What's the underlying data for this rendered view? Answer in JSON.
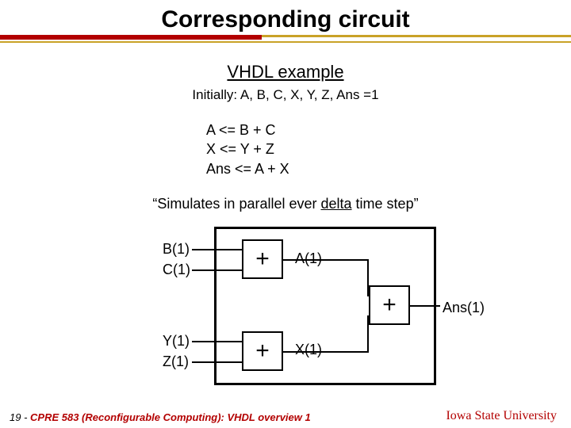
{
  "title": "Corresponding circuit",
  "subtitle": "VHDL example",
  "initial": "Initially: A, B, C, X, Y, Z, Ans =1",
  "code": {
    "l1": "A <= B + C",
    "l2": "X <= Y + Z",
    "l3": "Ans <= A + X"
  },
  "simnote_pre": "“Simulates in parallel ever ",
  "simnote_u": "delta",
  "simnote_post": " time step”",
  "signals": {
    "B": "B(1)",
    "C": "C(1)",
    "Y": "Y(1)",
    "Z": "Z(1)",
    "A": "A(1)",
    "X": "X(1)",
    "Ans": "Ans(1)"
  },
  "ops": {
    "plus": "+"
  },
  "footer": {
    "page": "19 - ",
    "course": "CPRE 583 (Reconfigurable Computing):  VHDL overview 1"
  },
  "university": "Iowa State University"
}
